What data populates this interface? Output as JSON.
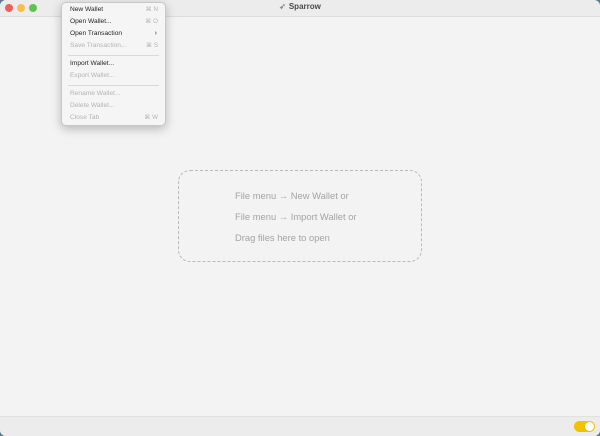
{
  "window": {
    "title": "Sparrow",
    "title_icon": "sparrow-logo-icon"
  },
  "file_menu": {
    "items": [
      {
        "label": "New Wallet",
        "shortcut": "⌘ N",
        "enabled": true
      },
      {
        "label": "Open Wallet...",
        "shortcut": "⌘ O",
        "enabled": true
      },
      {
        "label": "Open Transaction",
        "submenu": "›",
        "enabled": true
      },
      {
        "label": "Save Transaction...",
        "shortcut": "⌘ S",
        "enabled": false
      },
      {
        "label": "Import Wallet...",
        "enabled": true
      },
      {
        "label": "Export Wallet...",
        "enabled": false
      },
      {
        "label": "Rename Wallet...",
        "enabled": false
      },
      {
        "label": "Delete Wallet...",
        "enabled": false
      },
      {
        "label": "Close Tab",
        "shortcut": "⌘ W",
        "enabled": false
      }
    ]
  },
  "drop_zone": {
    "line1": "File menu → New Wallet or",
    "line2": "File menu → Import Wallet or",
    "line3": "Drag files here to open"
  },
  "statusbar": {
    "toggle_on": true,
    "toggle_color": "#f2c200"
  },
  "colors": {
    "close": "#ee5f57",
    "minimize": "#f5be4f",
    "maximize": "#5fc454"
  }
}
